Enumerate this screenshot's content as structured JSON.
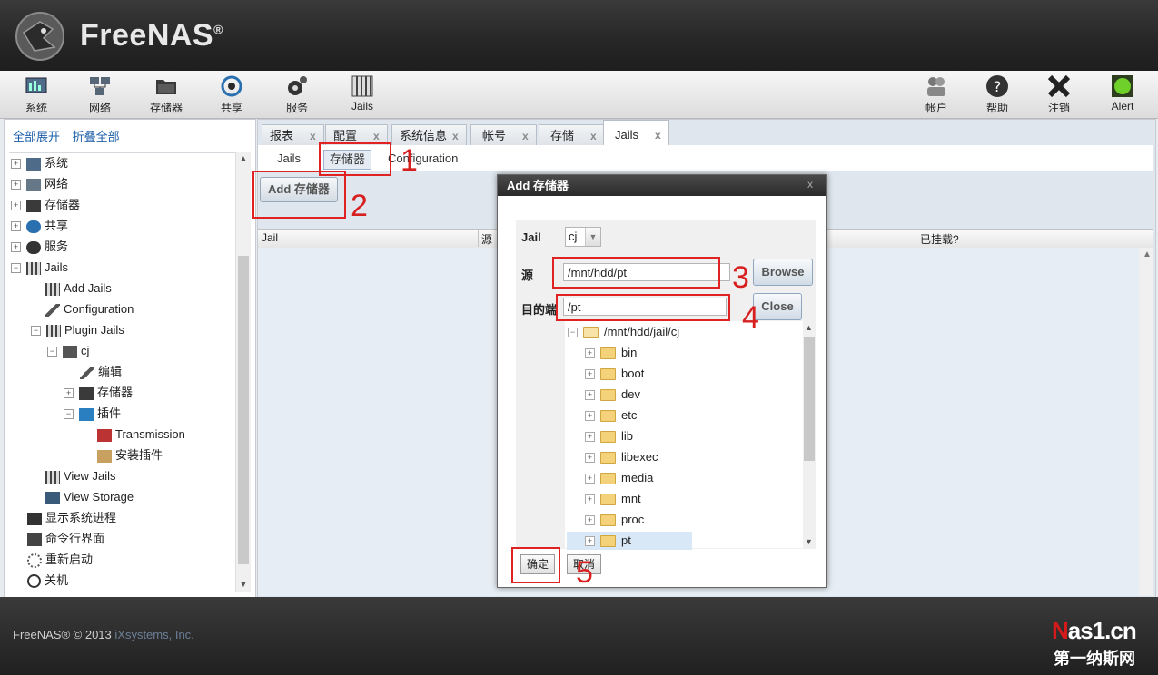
{
  "app": {
    "logo_text": "FreeNAS",
    "logo_mark": "®"
  },
  "toolbar": {
    "left": [
      {
        "label": "系统",
        "icon": "system-icon"
      },
      {
        "label": "网络",
        "icon": "network-icon"
      },
      {
        "label": "存储器",
        "icon": "storage-icon"
      },
      {
        "label": "共享",
        "icon": "share-icon"
      },
      {
        "label": "服务",
        "icon": "services-icon"
      },
      {
        "label": "Jails",
        "icon": "jails-icon"
      }
    ],
    "right": [
      {
        "label": "帐户",
        "icon": "account-icon"
      },
      {
        "label": "帮助",
        "icon": "help-icon"
      },
      {
        "label": "注销",
        "icon": "logout-icon"
      },
      {
        "label": "Alert",
        "icon": "alert-icon"
      }
    ]
  },
  "sidebar": {
    "expand_all": "全部展开",
    "collapse_all": "折叠全部",
    "tree": [
      {
        "label": "系统"
      },
      {
        "label": "网络"
      },
      {
        "label": "存储器"
      },
      {
        "label": "共享"
      },
      {
        "label": "服务"
      },
      {
        "label": "Jails"
      },
      {
        "label": "Add Jails"
      },
      {
        "label": "Configuration"
      },
      {
        "label": "Plugin Jails"
      },
      {
        "label": "cj"
      },
      {
        "label": "编辑"
      },
      {
        "label": "存储器"
      },
      {
        "label": "插件"
      },
      {
        "label": "Transmission"
      },
      {
        "label": "安装插件"
      },
      {
        "label": "View Jails"
      },
      {
        "label": "View Storage"
      },
      {
        "label": "显示系统进程"
      },
      {
        "label": "命令行界面"
      },
      {
        "label": "重新启动"
      },
      {
        "label": "关机"
      }
    ]
  },
  "tabs": [
    {
      "label": "报表"
    },
    {
      "label": "配置"
    },
    {
      "label": "系统信息"
    },
    {
      "label": "帐号"
    },
    {
      "label": "存储"
    },
    {
      "label": "Jails"
    }
  ],
  "close_glyph": "x",
  "subtabs": [
    {
      "label": "Jails"
    },
    {
      "label": "存储器"
    },
    {
      "label": "Configuration"
    }
  ],
  "add_button": "Add 存储器",
  "grid": {
    "columns": [
      "Jail",
      "源",
      "已挂载?"
    ]
  },
  "dialog": {
    "title": "Add 存储器",
    "close_glyph": "x",
    "jail_label": "Jail",
    "jail_value": "cj",
    "source_label": "源",
    "source_value": "/mnt/hdd/pt",
    "browse_button": "Browse",
    "dest_label": "目的端",
    "dest_value": "/pt",
    "close_button": "Close",
    "tree_root": "/mnt/hdd/jail/cj",
    "folders": [
      "bin",
      "boot",
      "dev",
      "etc",
      "lib",
      "libexec",
      "media",
      "mnt",
      "proc",
      "pt"
    ],
    "ok_button": "确定",
    "cancel_button": "取消"
  },
  "annotations": [
    "1",
    "2",
    "3",
    "4",
    "5"
  ],
  "footer": {
    "text": "FreeNAS® © 2013",
    "company": "iXsystems, Inc."
  },
  "watermark": {
    "top_n": "N",
    "top_rest": "as1.cn",
    "bottom": "第一纳斯网"
  }
}
